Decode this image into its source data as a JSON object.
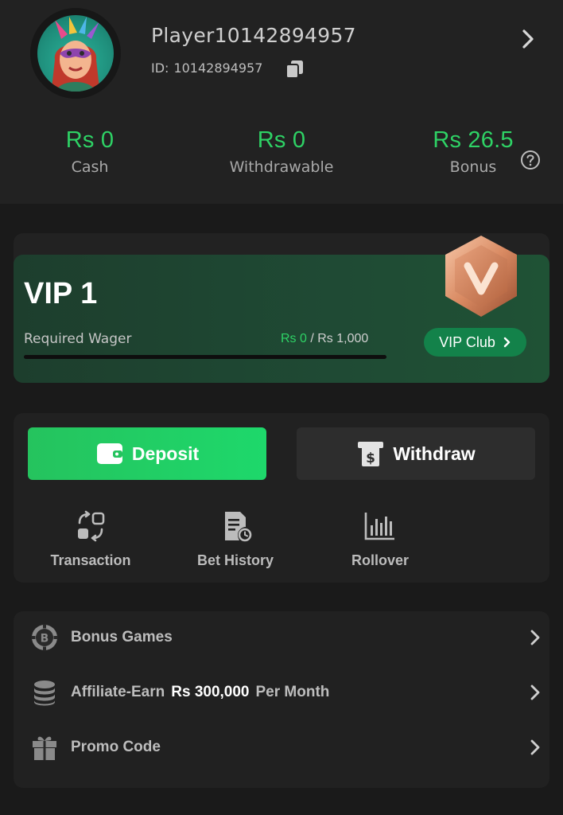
{
  "profile": {
    "username": "Player10142894957",
    "id_label": "ID:",
    "id_value": "10142894957"
  },
  "balances": [
    {
      "value": "Rs 0",
      "label": "Cash"
    },
    {
      "value": "Rs 0",
      "label": "Withdrawable"
    },
    {
      "value": "Rs 26.5",
      "label": "Bonus"
    }
  ],
  "vip": {
    "level": "VIP 1",
    "wager_label": "Required Wager",
    "wager_current": "Rs 0",
    "wager_separator": " / ",
    "wager_target": "Rs 1,000",
    "wager_progress": 0,
    "club_button": "VIP Club"
  },
  "wallet": {
    "deposit_label": "Deposit",
    "withdraw_label": "Withdraw",
    "quick_links": [
      {
        "label": "Transaction",
        "icon": "transaction-icon"
      },
      {
        "label": "Bet History",
        "icon": "bet-history-icon"
      },
      {
        "label": "Rollover",
        "icon": "rollover-icon"
      }
    ]
  },
  "menu": {
    "bonus_games": "Bonus Games",
    "affiliate_prefix": "Affiliate-Earn",
    "affiliate_amount": "Rs 300,000",
    "affiliate_suffix": "Per Month",
    "promo_code": "Promo Code"
  },
  "colors": {
    "accent_green": "#2ed265",
    "background": "#1a1a1a",
    "panel": "#212121",
    "vip_card": "#1f4a34"
  }
}
